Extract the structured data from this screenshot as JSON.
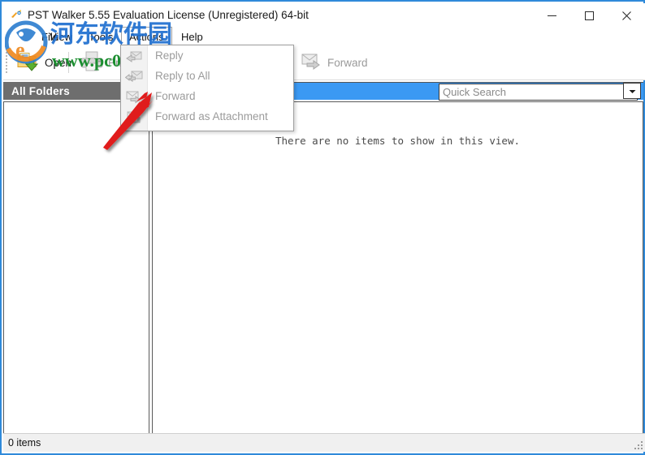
{
  "window": {
    "title": "PST Walker 5.55 Evaluation License (Unregistered) 64-bit",
    "app_icon": "pst-walker-icon",
    "controls": {
      "minimize": "minimize-icon",
      "maximize": "maximize-icon",
      "close": "close-icon"
    },
    "border_color": "#2f8ada"
  },
  "menubar": {
    "items": [
      {
        "label": "File",
        "active": false
      },
      {
        "label": "View",
        "active": false
      },
      {
        "label": "Tools",
        "active": false
      },
      {
        "label": "Actions",
        "active": true
      },
      {
        "label": "Help",
        "active": false
      }
    ]
  },
  "toolbar": {
    "buttons": [
      {
        "label": "Open",
        "icon": "open-folder-icon",
        "enabled": true
      },
      {
        "label": "Pri",
        "icon": "printer-icon",
        "enabled": true
      },
      {
        "label": "Reply",
        "icon": "reply-icon",
        "enabled": false
      },
      {
        "label": "Reply to All",
        "icon": "reply-all-icon",
        "enabled": false
      },
      {
        "label": "Forward",
        "icon": "forward-icon",
        "enabled": false
      }
    ]
  },
  "actions_menu": {
    "open": true,
    "items": [
      {
        "label": "Reply",
        "icon": "reply-icon",
        "enabled": false
      },
      {
        "label": "Reply to All",
        "icon": "reply-all-icon",
        "enabled": false
      },
      {
        "label": "Forward",
        "icon": "forward-icon",
        "enabled": false
      },
      {
        "label": "Forward as Attachment",
        "icon": "attachment-icon",
        "enabled": false
      }
    ]
  },
  "folders_panel": {
    "header": "All Folders",
    "header_bg": "#6e6e6e",
    "items": []
  },
  "search": {
    "placeholder": "Quick Search",
    "value": "",
    "bar_color": "#3b99f3",
    "icon": "search-icon",
    "dropdown_icon": "chevron-down-icon"
  },
  "message_list": {
    "empty_message": "There are no items to show in this view."
  },
  "statusbar": {
    "text": "0 items",
    "grip": "resize-grip-icon"
  },
  "watermark": {
    "chinese_text": "河东软件园",
    "url_text": "www.pc0359.cn",
    "chinese_color": "#1f6fd0",
    "url_color": "#128a28",
    "logo": "he-dong-logo-icon"
  },
  "annotation": {
    "arrow": "red-arrow-pointer",
    "color": "#e01b1b",
    "points_to": "Forward"
  }
}
